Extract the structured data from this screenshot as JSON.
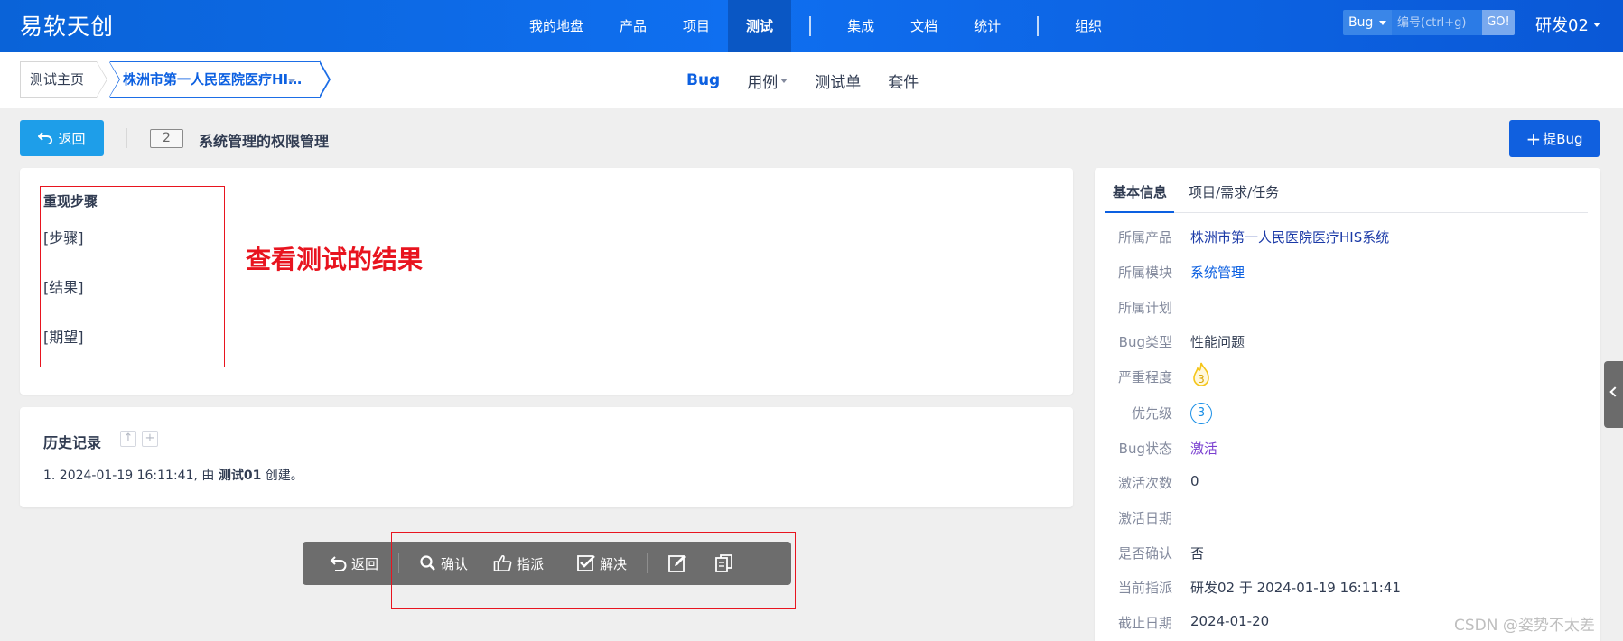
{
  "app": {
    "brand": "易软天创"
  },
  "topnav": {
    "items": [
      "我的地盘",
      "产品",
      "项目",
      "测试",
      "集成",
      "文档",
      "统计",
      "组织"
    ],
    "active": "测试"
  },
  "search": {
    "type": "Bug",
    "placeholder": "编号(ctrl+g)",
    "go_label": "GO!"
  },
  "user": {
    "name": "研发02"
  },
  "breadcrumb": {
    "home": "测试主页",
    "product": "株洲市第一人民医院医疗HIS系统"
  },
  "subnav": {
    "tabs": [
      "Bug",
      "用例",
      "测试单",
      "套件"
    ]
  },
  "bug": {
    "back_label": "返回",
    "id": "2",
    "title": "系统管理的权限管理",
    "create_label": "提Bug"
  },
  "steps": {
    "heading": "重现步骤",
    "lines": [
      "[步骤]",
      "[结果]",
      "[期望]"
    ],
    "annotation": "查看测试的结果"
  },
  "history": {
    "heading": "历史记录",
    "entry_prefix": "1. 2024-01-19 16:11:41, 由 ",
    "entry_actor": "测试01",
    "entry_suffix": " 创建。"
  },
  "actions": {
    "back": "返回",
    "confirm": "确认",
    "assign": "指派",
    "resolve": "解决"
  },
  "sidebar": {
    "tabs": [
      "基本信息",
      "项目/需求/任务"
    ],
    "fields": [
      {
        "label": "所属产品",
        "value": "株洲市第一人民医院医疗HIS系统"
      },
      {
        "label": "所属模块",
        "value": "系统管理"
      },
      {
        "label": "所属计划",
        "value": ""
      },
      {
        "label": "Bug类型",
        "value": "性能问题"
      },
      {
        "label": "严重程度",
        "value": "3"
      },
      {
        "label": "优先级",
        "value": "3"
      },
      {
        "label": "Bug状态",
        "value": "激活"
      },
      {
        "label": "激活次数",
        "value": "0"
      },
      {
        "label": "激活日期",
        "value": ""
      },
      {
        "label": "是否确认",
        "value": "否"
      },
      {
        "label": "当前指派",
        "value": "研发02 于 2024-01-19 16:11:41"
      },
      {
        "label": "截止日期",
        "value": "2024-01-20"
      }
    ]
  },
  "watermark": "CSDN @姿势不太差",
  "colors": {
    "brand_blue": "#0f6ff0",
    "accent": "#0c60e1",
    "annotation_red": "#e8141f",
    "back_button": "#1e9ee9"
  }
}
